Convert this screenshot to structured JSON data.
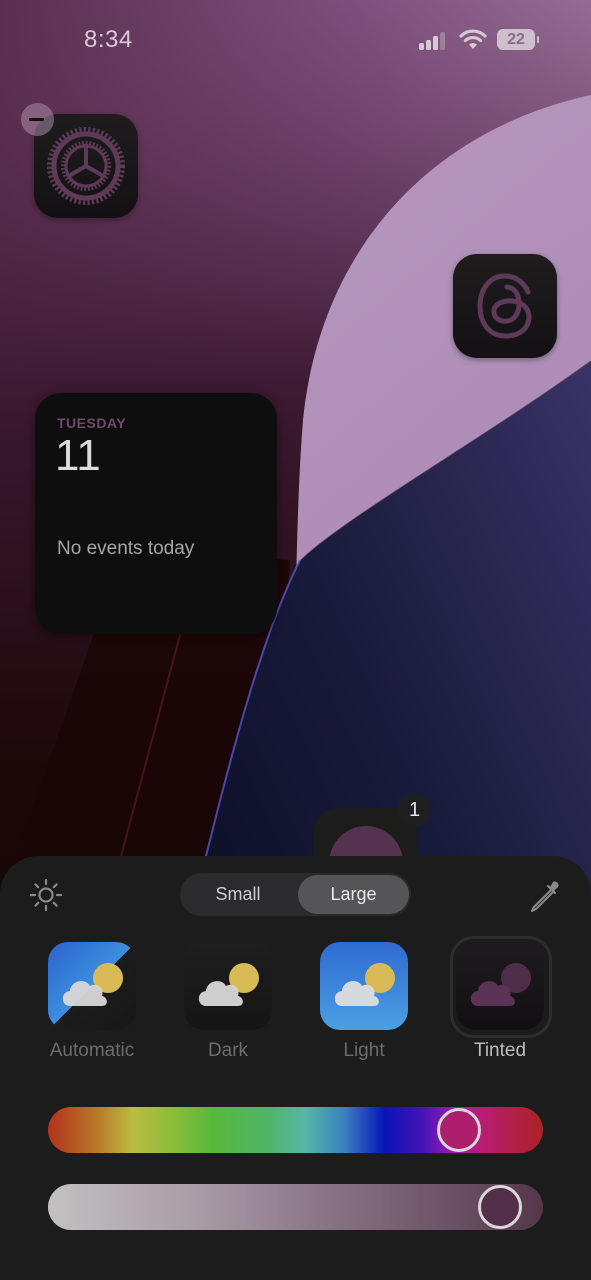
{
  "status_bar": {
    "time": "8:34",
    "signal_bars_active": 3,
    "signal_bars_total": 4,
    "wifi": "wifi-icon",
    "battery_percent": "22"
  },
  "home_screen": {
    "apps": [
      {
        "name": "Settings",
        "icon": "gear-icon",
        "edit_badge": "remove-icon"
      },
      {
        "name": "Threads",
        "icon": "threads-icon"
      },
      {
        "name": "App",
        "icon": "app-icon",
        "notification_count": "1"
      }
    ],
    "calendar_widget": {
      "day": "TUESDAY",
      "date": "11",
      "events_text": "No events today"
    }
  },
  "customize_sheet": {
    "brightness_icon": "sun-icon",
    "eyedropper_icon": "eyedropper-icon",
    "size_toggle": {
      "options": [
        "Small",
        "Large"
      ],
      "selected": "Large"
    },
    "styles": [
      {
        "label": "Automatic",
        "icon": "weather-automatic-icon"
      },
      {
        "label": "Dark",
        "icon": "weather-dark-icon"
      },
      {
        "label": "Light",
        "icon": "weather-light-icon"
      },
      {
        "label": "Tinted",
        "icon": "weather-tinted-icon"
      }
    ],
    "selected_style": "Tinted",
    "hue_slider": {
      "value_fraction": 0.865,
      "color": "#ad1f6c"
    },
    "tint_slider": {
      "value_fraction": 0.955,
      "color": "#542f4a"
    }
  }
}
